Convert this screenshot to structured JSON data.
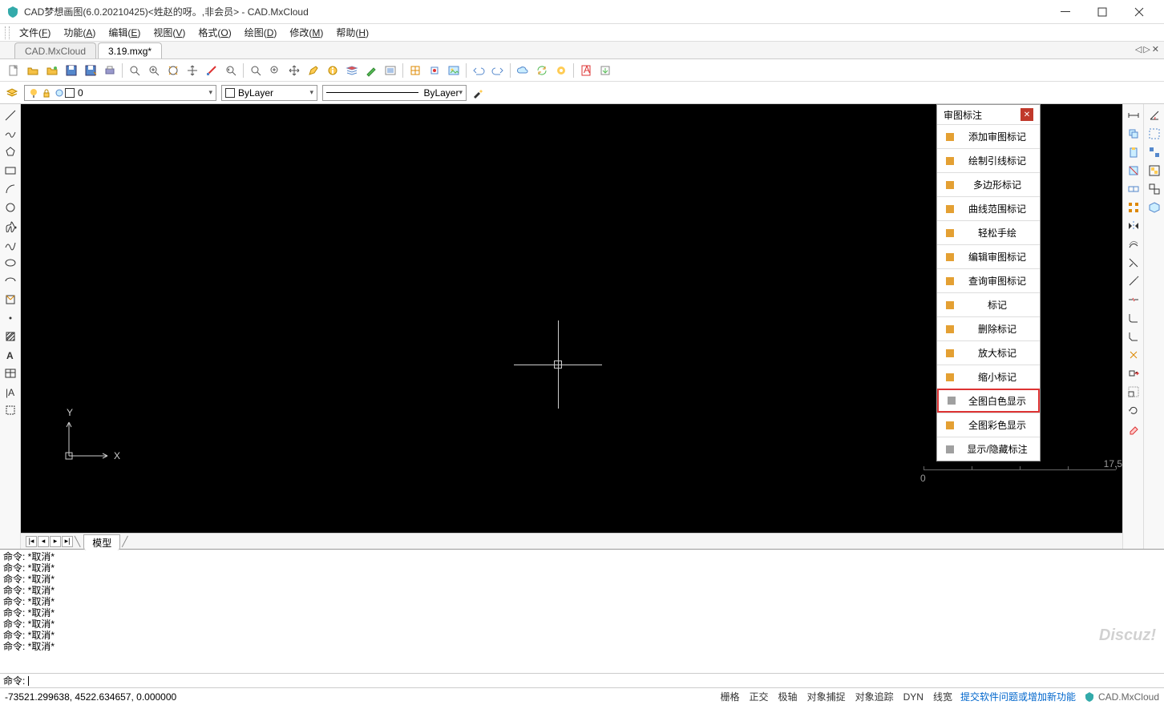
{
  "title": "CAD梦想画图(6.0.20210425)<姓赵的呀。,非会员> - CAD.MxCloud",
  "menu": [
    {
      "label": "文件",
      "key": "F"
    },
    {
      "label": "功能",
      "key": "A"
    },
    {
      "label": "编辑",
      "key": "E"
    },
    {
      "label": "视图",
      "key": "V"
    },
    {
      "label": "格式",
      "key": "O"
    },
    {
      "label": "绘图",
      "key": "D"
    },
    {
      "label": "修改",
      "key": "M"
    },
    {
      "label": "帮助",
      "key": "H"
    }
  ],
  "tabs": [
    {
      "label": "CAD.MxCloud",
      "active": false
    },
    {
      "label": "3.19.mxg*",
      "active": true
    }
  ],
  "layer": {
    "current": "0",
    "color_label": "ByLayer",
    "linetype_label": "ByLayer"
  },
  "panel": {
    "title": "审图标注",
    "items": [
      {
        "label": "添加审图标记",
        "hl": false
      },
      {
        "label": "绘制引线标记",
        "hl": false
      },
      {
        "label": "多边形标记",
        "hl": false
      },
      {
        "label": "曲线范围标记",
        "hl": false
      },
      {
        "label": "轻松手绘",
        "hl": false
      },
      {
        "label": "编辑审图标记",
        "hl": false
      },
      {
        "label": "查询审图标记",
        "hl": false
      },
      {
        "label": "标记",
        "hl": false
      },
      {
        "label": "删除标记",
        "hl": false
      },
      {
        "label": "放大标记",
        "hl": false
      },
      {
        "label": "缩小标记",
        "hl": false
      },
      {
        "label": "全图白色显示",
        "hl": true
      },
      {
        "label": "全图彩色显示",
        "hl": false
      },
      {
        "label": "显示/隐藏标注",
        "hl": false
      }
    ]
  },
  "modeltab": "模型",
  "cmd": {
    "lines": [
      "命令:   *取消*",
      "命令:   *取消*",
      "命令:   *取消*",
      "命令:   *取消*",
      "命令:   *取消*",
      "命令:   *取消*",
      "命令:   *取消*",
      "命令:   *取消*",
      "命令:   *取消*"
    ],
    "prompt": "命令:"
  },
  "ruler": {
    "min": "0",
    "max": "17.5"
  },
  "status": {
    "coords": "-73521.299638,  4522.634657,  0.000000",
    "toggles": [
      "栅格",
      "正交",
      "极轴",
      "对象捕捉",
      "对象追踪",
      "DYN",
      "线宽"
    ],
    "link": "提交软件问题或增加新功能",
    "brand": "CAD.MxCloud"
  },
  "watermark": "Discuz!"
}
